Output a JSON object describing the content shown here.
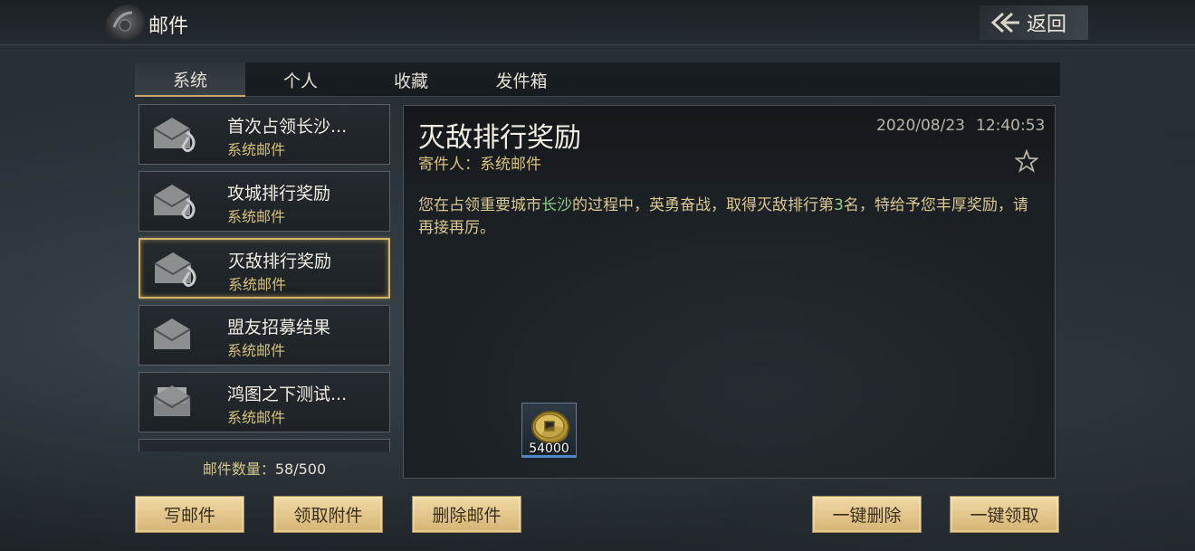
{
  "header": {
    "title": "邮件",
    "back_label": "返回"
  },
  "tabs": [
    {
      "label": "系统",
      "active": true
    },
    {
      "label": "个人",
      "active": false
    },
    {
      "label": "收藏",
      "active": false
    },
    {
      "label": "发件箱",
      "active": false
    }
  ],
  "mail_list": [
    {
      "title": "首次占领长沙...",
      "sender": "系统邮件",
      "icon": "envelope-attachment-icon",
      "selected": false
    },
    {
      "title": "攻城排行奖励",
      "sender": "系统邮件",
      "icon": "envelope-attachment-icon",
      "selected": false
    },
    {
      "title": "灭敌排行奖励",
      "sender": "系统邮件",
      "icon": "envelope-attachment-icon",
      "selected": true
    },
    {
      "title": "盟友招募结果",
      "sender": "系统邮件",
      "icon": "envelope-icon",
      "selected": false
    },
    {
      "title": "鸿图之下测试...",
      "sender": "系统邮件",
      "icon": "envelope-letter-icon",
      "selected": false
    }
  ],
  "mail_count": {
    "label": "邮件数量：",
    "value": "58/500"
  },
  "detail": {
    "title": "灭敌排行奖励",
    "sender": "寄件人：系统邮件",
    "date": "2020/08/23",
    "time": "12:40:53",
    "body_pre": "您在占领重要城市",
    "body_city": "长沙",
    "body_mid": "的过程中，英勇奋战，取得灭敌排行第",
    "body_rank": "3",
    "body_post": "名，特给予您丰厚奖励，请再接再厉。",
    "reward": {
      "icon": "copper-coin-icon",
      "quantity": "54000"
    }
  },
  "buttons": {
    "write": "写邮件",
    "claim_attachment": "领取附件",
    "delete_mail": "删除邮件",
    "delete_all": "一键删除",
    "claim_all": "一键领取"
  },
  "colors": {
    "gold_text": "#d7c27c",
    "highlight_green": "#8fcf8a",
    "button_gold": "#e2c58a",
    "selected_border": "#d6b56a"
  }
}
